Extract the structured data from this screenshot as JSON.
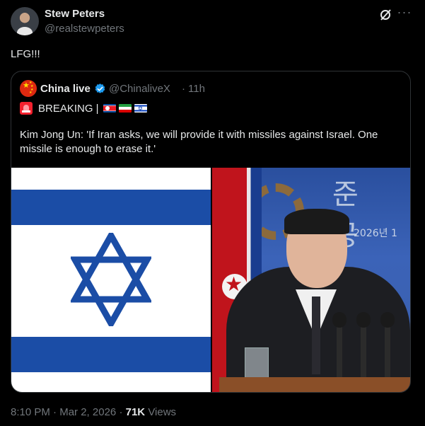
{
  "post": {
    "author_name": "Stew Peters",
    "author_handle": "@realstewpeters",
    "text": "LFG!!!",
    "time": "8:10 PM",
    "separator": "·",
    "date": "Mar 2, 2026",
    "views_count": "71K",
    "views_label": "Views",
    "more_icon": "more-horizontal-icon",
    "grok_icon": "grok-icon"
  },
  "quote": {
    "author_name": "China live",
    "author_handle": "@ChinaliveX",
    "separator": "·",
    "time": "11h",
    "verified_color": "#1d9bf0",
    "line1": "BREAKING |",
    "flags": [
      "north-korea-flag",
      "iran-flag",
      "israel-flag"
    ],
    "body": "Kim Jong Un: 'If Iran asks, we will provide it with missiles against Israel. One missile is enough to erase it.'",
    "banner_text": "준 공",
    "banner_number": "2026년 1"
  },
  "colors": {
    "background": "#000000",
    "text_primary": "#e7e9ea",
    "text_secondary": "#71767b",
    "border": "#2f3336",
    "israel_blue": "#1b4da6"
  }
}
